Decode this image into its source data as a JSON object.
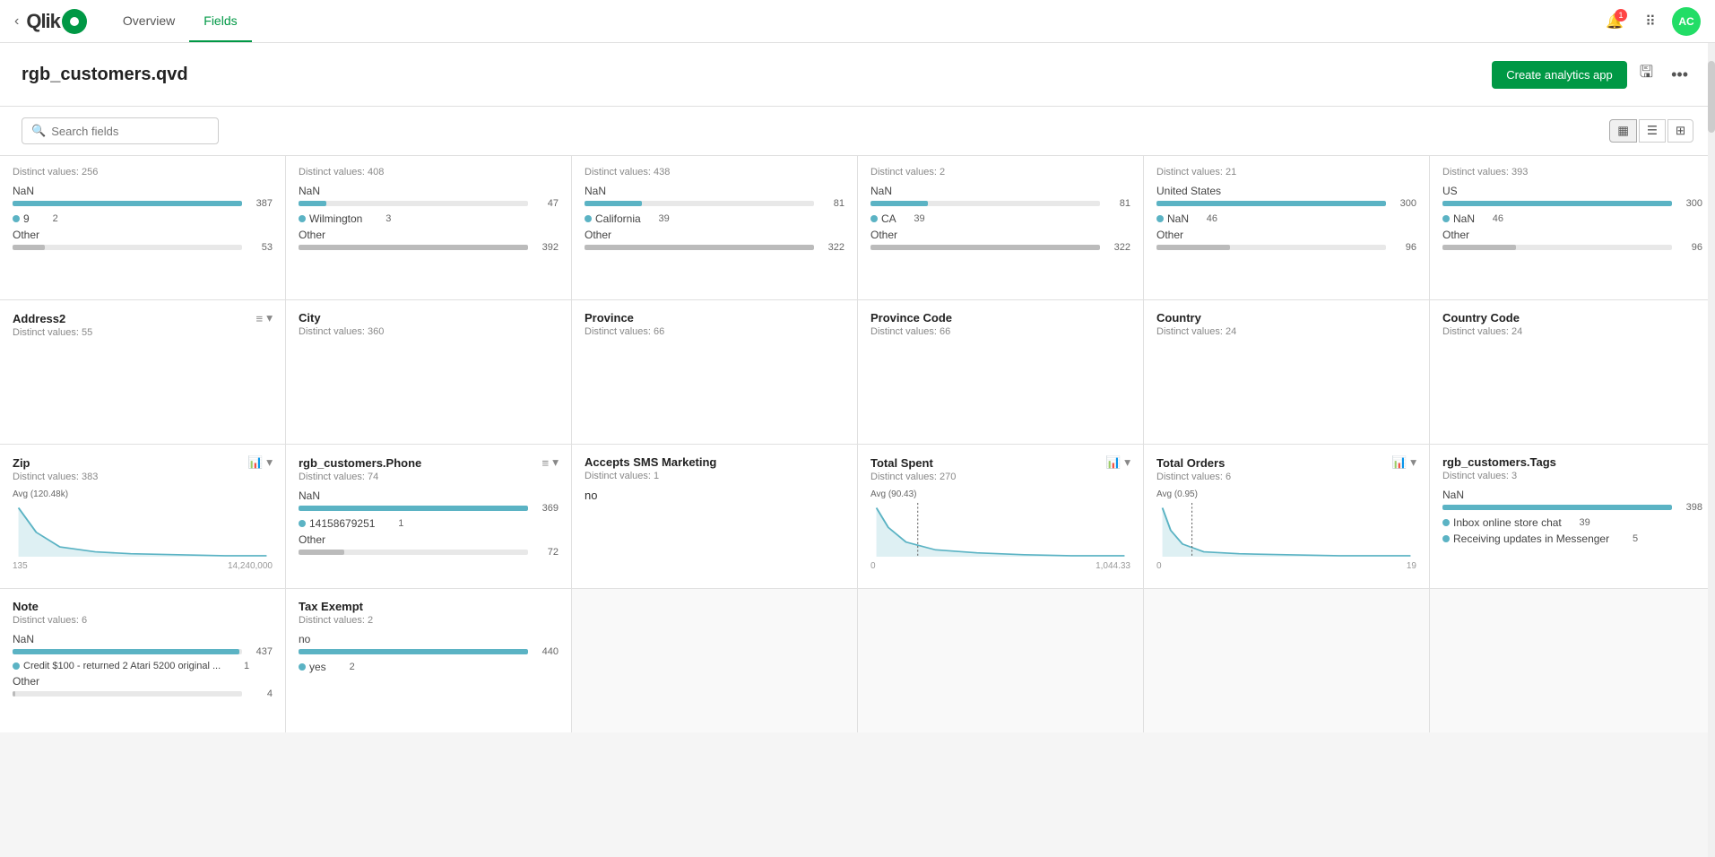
{
  "header": {
    "back_icon": "‹",
    "logo_text": "Qlik",
    "nav_tabs": [
      {
        "label": "Overview",
        "active": false
      },
      {
        "label": "Fields",
        "active": true
      }
    ],
    "notification_count": "1",
    "apps_icon": "⠿",
    "avatar_initials": "AC"
  },
  "page": {
    "title": "rgb_customers.qvd",
    "create_btn": "Create analytics app",
    "save_icon": "🖫",
    "more_icon": "…"
  },
  "toolbar": {
    "search_placeholder": "Search fields",
    "view_grid_icon": "▦",
    "view_list_icon": "☰",
    "view_table_icon": "⊞"
  },
  "fields": [
    {
      "id": "address2",
      "name": "Address2",
      "distinct_values": "Distinct values: 55",
      "type": "text",
      "has_sort": true,
      "has_chevron": true,
      "values": [
        {
          "label": "NaN",
          "value": 437,
          "max": 440,
          "type": "bar"
        },
        {
          "label": "Credit $100 - returned 2 Atari 5200 original ...",
          "value": 1,
          "type": "dot"
        },
        {
          "label": "Other",
          "value": 4,
          "type": "gray"
        }
      ],
      "sub_name": "Note",
      "sub_distinct": "Distinct values: 6"
    },
    {
      "id": "city",
      "name": "City",
      "distinct_values": "Distinct values: 360",
      "type": "text",
      "values": [
        {
          "label": "NaN",
          "value": 47,
          "max": 392,
          "type": "bar"
        },
        {
          "label": "Wilmington",
          "value": 3,
          "type": "dot"
        },
        {
          "label": "Other",
          "value": 392,
          "max": 392,
          "type": "gray"
        }
      ],
      "sub_name": "rgb_customers.Phone",
      "sub_distinct": "Distinct values: 74",
      "sub_has_sort": true,
      "sub_has_chevron": true
    },
    {
      "id": "province",
      "name": "Province",
      "distinct_values": "Distinct values: 66",
      "type": "text",
      "values": [
        {
          "label": "NaN",
          "value": 81,
          "max": 322,
          "type": "bar"
        },
        {
          "label": "California",
          "value": 39,
          "type": "dot"
        },
        {
          "label": "Other",
          "value": 322,
          "max": 322,
          "type": "gray"
        }
      ],
      "sub_name": "Accepts SMS Marketing",
      "sub_distinct": "Distinct values: 1"
    },
    {
      "id": "province_code",
      "name": "Province Code",
      "distinct_values": "Distinct values: 66",
      "type": "text",
      "values": [
        {
          "label": "NaN",
          "value": 81,
          "max": 322,
          "type": "bar"
        },
        {
          "label": "CA",
          "value": 39,
          "type": "dot"
        },
        {
          "label": "Other",
          "value": 322,
          "max": 322,
          "type": "gray"
        }
      ],
      "sub_name": "Total Spent",
      "sub_distinct": "Distinct values: 270",
      "sub_has_chart": true,
      "sub_chart_avg": "Avg (90.43)",
      "sub_chart_min": "0",
      "sub_chart_max": "1,044.33"
    },
    {
      "id": "country",
      "name": "Country",
      "distinct_values": "Distinct values: 24",
      "type": "text",
      "values": [
        {
          "label": "United States",
          "value": 300,
          "max": 300,
          "type": "bar"
        },
        {
          "label": "NaN",
          "value": 46,
          "type": "dot"
        },
        {
          "label": "Other",
          "value": 96,
          "max": 300,
          "type": "gray"
        }
      ],
      "sub_name": "Total Orders",
      "sub_distinct": "Distinct values: 6",
      "sub_has_chart": true,
      "sub_chart_avg": "Avg (0.95)",
      "sub_chart_min": "0",
      "sub_chart_max": "19"
    },
    {
      "id": "country_code",
      "name": "Country Code",
      "distinct_values": "Distinct values: 24",
      "type": "text",
      "values": [
        {
          "label": "US",
          "value": 300,
          "max": 300,
          "type": "bar"
        },
        {
          "label": "NaN",
          "value": 46,
          "type": "dot"
        },
        {
          "label": "Other",
          "value": 96,
          "max": 300,
          "type": "gray"
        }
      ],
      "sub_name": "rgb_customers.Tags",
      "sub_distinct": "Distinct values: 3"
    }
  ],
  "top_row": [
    {
      "distinct": "Distinct values: 256"
    },
    {
      "distinct": "Distinct values: 408"
    },
    {
      "distinct": "Distinct values: 438"
    },
    {
      "distinct": "Distinct values: 2"
    },
    {
      "distinct": "Distinct values: 21"
    },
    {
      "distinct": "Distinct values: 393"
    }
  ],
  "top_row_values": [
    {
      "values": [
        {
          "label": "NaN",
          "value": 387,
          "max": 387,
          "type": "bar"
        },
        {
          "label": "9",
          "value": 2,
          "type": "dot"
        },
        {
          "label": "Other",
          "value": 53,
          "max": 387,
          "type": "gray"
        }
      ]
    },
    {
      "values": [
        {
          "label": "NaN",
          "value": 47,
          "max": 392,
          "type": "bar"
        },
        {
          "label": "Wilmington",
          "value": 3,
          "type": "dot"
        },
        {
          "label": "Other",
          "value": 392,
          "max": 392,
          "type": "gray"
        }
      ]
    },
    {
      "values": [
        {
          "label": "NaN",
          "value": 81,
          "max": 322,
          "type": "bar"
        },
        {
          "label": "California",
          "value": 39,
          "type": "dot"
        },
        {
          "label": "Other",
          "value": 322,
          "max": 322,
          "type": "gray"
        }
      ]
    },
    {
      "values": [
        {
          "label": "NaN",
          "value": 81,
          "max": 322,
          "type": "bar"
        },
        {
          "label": "CA",
          "value": 39,
          "type": "dot"
        },
        {
          "label": "Other",
          "value": 322,
          "max": 322,
          "type": "gray"
        }
      ]
    },
    {
      "values": [
        {
          "label": "United States",
          "value": 300,
          "max": 300,
          "type": "bar"
        },
        {
          "label": "NaN",
          "value": 46,
          "type": "dot"
        },
        {
          "label": "Other",
          "value": 96,
          "max": 300,
          "type": "gray"
        }
      ]
    },
    {
      "values": [
        {
          "label": "US",
          "value": 300,
          "max": 300,
          "type": "bar"
        },
        {
          "label": "NaN",
          "value": 46,
          "type": "dot"
        },
        {
          "label": "Other",
          "value": 96,
          "max": 300,
          "type": "gray"
        }
      ]
    }
  ],
  "zip_row": {
    "name": "Zip",
    "distinct": "Distinct values: 383",
    "has_chart": true,
    "chart_avg": "Avg (120.48k)",
    "chart_min": "135",
    "chart_max": "14,240,000"
  },
  "phone_row": {
    "name": "rgb_customers.Phone",
    "distinct": "Distinct values: 74",
    "values": [
      {
        "label": "NaN",
        "value": 369,
        "max": 369,
        "type": "bar"
      },
      {
        "label": "14158679251",
        "value": 1,
        "type": "dot"
      },
      {
        "label": "Other",
        "value": 72,
        "max": 369,
        "type": "gray"
      }
    ]
  },
  "sms_row": {
    "name": "Accepts SMS Marketing",
    "distinct": "Distinct values: 1",
    "values": [
      {
        "label": "no",
        "value": null,
        "type": "text_only"
      }
    ]
  },
  "total_spent_row": {
    "name": "Total Spent",
    "distinct": "Distinct values: 270",
    "has_chart": true,
    "chart_avg": "Avg (90.43)",
    "chart_min": "0",
    "chart_max": "1,044.33"
  },
  "total_orders_row": {
    "name": "Total Orders",
    "distinct": "Distinct values: 6",
    "has_chart": true,
    "chart_avg": "Avg (0.95)",
    "chart_min": "0",
    "chart_max": "19"
  },
  "tags_row": {
    "name": "rgb_customers.Tags",
    "distinct": "Distinct values: 3",
    "values": [
      {
        "label": "NaN",
        "value": 398,
        "max": 398,
        "type": "bar"
      },
      {
        "label": "Inbox online store chat",
        "value": 39,
        "type": "dot"
      },
      {
        "label": "Receiving updates in Messenger",
        "value": 5,
        "type": "dot2"
      }
    ]
  },
  "note_row": {
    "name": "Note",
    "distinct": "Distinct values: 6",
    "values": [
      {
        "label": "NaN",
        "value": 437,
        "max": 440,
        "type": "bar"
      },
      {
        "label": "Credit $100 - returned 2 Atari 5200 original ...",
        "value": 1,
        "type": "dot"
      },
      {
        "label": "Other",
        "value": 4,
        "type": "gray"
      }
    ]
  },
  "tax_exempt_row": {
    "name": "Tax Exempt",
    "distinct": "Distinct values: 2",
    "values": [
      {
        "label": "no",
        "value": 440,
        "max": 440,
        "type": "bar"
      },
      {
        "label": "yes",
        "value": 2,
        "type": "dot"
      }
    ]
  }
}
